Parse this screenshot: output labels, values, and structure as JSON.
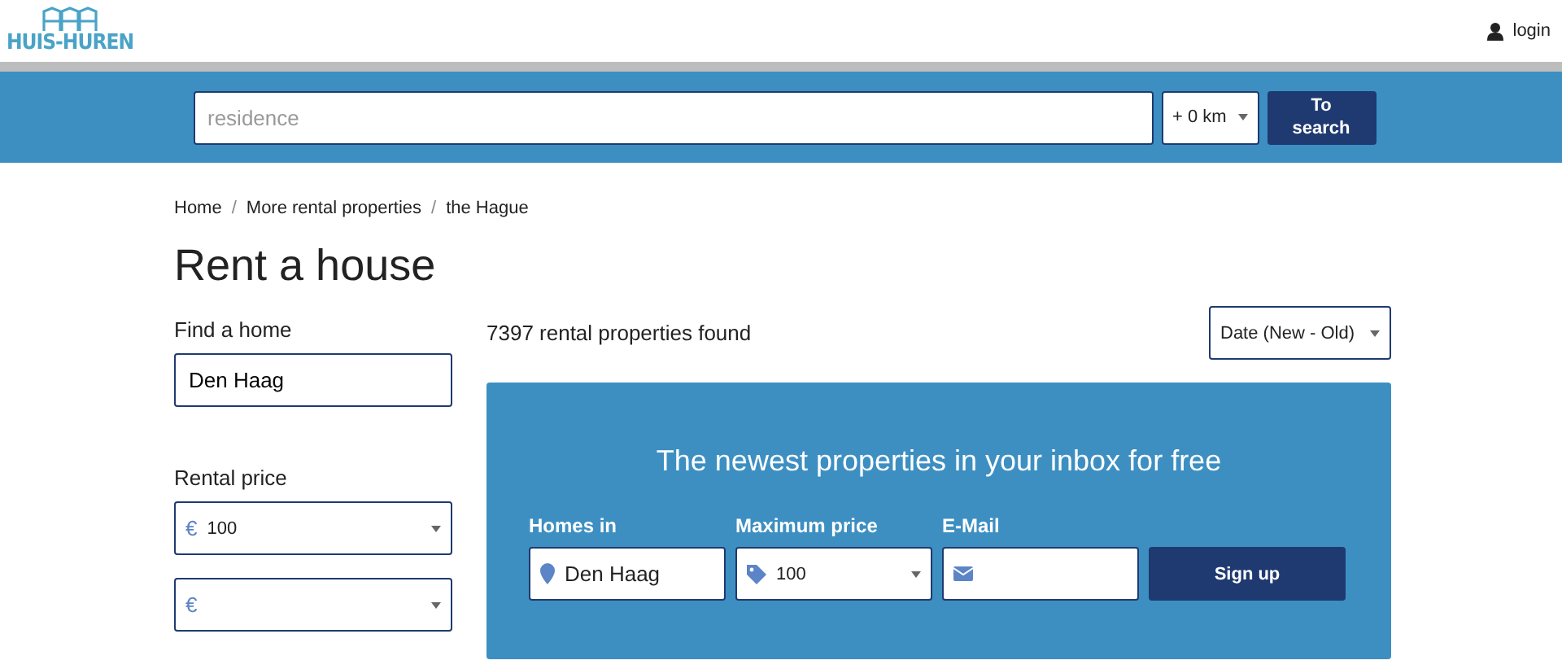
{
  "header": {
    "logo_text": "HUIS-HUREN",
    "login": "login"
  },
  "search": {
    "placeholder": "residence",
    "radius": "+ 0 km",
    "button": "To\nsearch"
  },
  "breadcrumb": {
    "items": [
      "Home",
      "More rental properties",
      "the Hague"
    ],
    "separator": "/"
  },
  "title": "Rent a house",
  "filters": {
    "find_label": "Find a home",
    "find_value": "Den Haag",
    "price_label": "Rental price",
    "price_min_symbol": "€",
    "price_min": "100",
    "price_max_symbol": "€"
  },
  "results": {
    "count": "7397 rental properties found",
    "sort": "Date (New - Old)"
  },
  "alert": {
    "heading": "The newest properties in your inbox for free",
    "homes_label": "Homes in",
    "homes_value": "Den Haag",
    "price_label": "Maximum price",
    "price_value": "100",
    "email_label": "E-Mail",
    "button": "Sign up"
  }
}
